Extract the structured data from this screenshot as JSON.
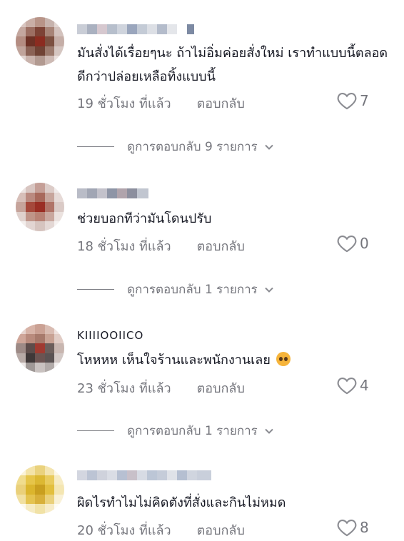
{
  "comments": [
    {
      "text": "มันสั่งได้เรื่อยๆนะ ถ้าไม่อิ่มค่อยสั่งใหม่ เราทำแบบนี้ตลอด ดีกว่าปล่อยเหลือทิ้งแบบนี้",
      "time": "19 ชั่วโมง ที่แล้ว",
      "reply_label": "ตอบกลับ",
      "likes": "7",
      "view_replies": "ดูการตอบกลับ 9 รายการ"
    },
    {
      "text": "ช่วยบอกทีว่ามันโดนปรับ",
      "time": "18 ชั่วโมง ที่แล้ว",
      "reply_label": "ตอบกลับ",
      "likes": "0",
      "view_replies": "ดูการตอบกลับ 1 รายการ"
    },
    {
      "username": "KIIIIOOIICO",
      "text": "โหหหห เห็นใจร้านและพนักงานเลย",
      "emoji": "pleading-face-emoji",
      "time": "23 ชั่วโมง ที่แล้ว",
      "reply_label": "ตอบกลับ",
      "likes": "4",
      "view_replies": "ดูการตอบกลับ 1 รายการ"
    },
    {
      "text": "ผิดไรทำไมไม่คิดตังที่สั่งและกินไม่หมด",
      "time": "20 ชั่วโมง ที่แล้ว",
      "reply_label": "ตอบกลับ",
      "likes": "8"
    }
  ],
  "icons": {
    "like": "heart-outline-icon",
    "expand": "chevron-down-icon"
  },
  "colors": {
    "text": "#161823",
    "secondary": "#8a8b91"
  }
}
